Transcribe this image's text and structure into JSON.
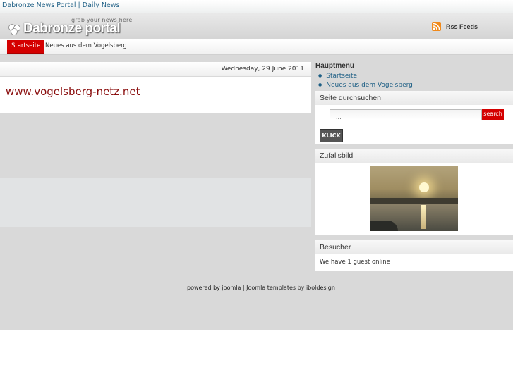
{
  "topbar": {
    "title": "Dabronze News Portal | Daily News"
  },
  "header": {
    "logo_name": "Dabronze portal",
    "logo_tagline": "grab your news here",
    "rss_label": "Rss Feeds"
  },
  "nav": {
    "items": [
      {
        "label": "Startseite",
        "active": true
      },
      {
        "label": "Neues aus dem Vogelsberg",
        "active": false
      }
    ]
  },
  "main": {
    "date": "Wednesday, 29 June 2011",
    "article_title": "www.vogelsberg-netz.net"
  },
  "sidebar": {
    "hauptmenu": {
      "title": "Hauptmenü",
      "items": [
        "Startseite",
        "Neues aus dem Vogelsberg"
      ]
    },
    "search": {
      "title": "Seite durchsuchen",
      "placeholder": "...",
      "search_button": "search",
      "klick_button": "KLICK"
    },
    "random_image": {
      "title": "Zufallsbild"
    },
    "visitors": {
      "title": "Besucher",
      "text": "We have 1 guest online"
    }
  },
  "footer": {
    "text": "powered by joomla | Joomla templates by iboldesign"
  },
  "colors": {
    "accent": "#d40000",
    "link": "#1e5f85",
    "title": "#8a0e0e"
  }
}
